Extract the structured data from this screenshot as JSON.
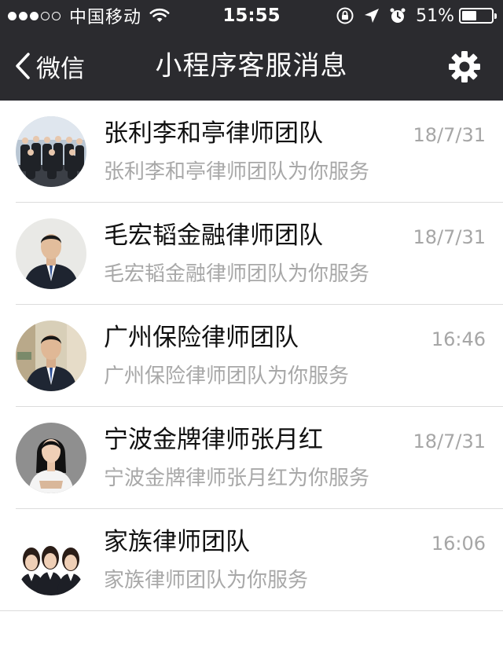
{
  "status_bar": {
    "carrier": "中国移动",
    "time": "15:55",
    "battery_percent": "51%",
    "battery_level": 0.51,
    "signal_bars_filled": 3,
    "signal_bars_total": 5
  },
  "nav": {
    "back_label": "微信",
    "title": "小程序客服消息",
    "back_icon": "chevron-left-icon",
    "settings_icon": "gear-icon"
  },
  "colors": {
    "header_bg": "#2b2b2f",
    "title_text": "#111111",
    "secondary_text": "#a8a8a8",
    "divider": "#dcdcdc"
  },
  "conversations": [
    {
      "name": "张利李和亭律师团队",
      "time": "18/7/31",
      "preview": "张利李和亭律师团队为你服务",
      "avatar": "group-photo-avatar"
    },
    {
      "name": "毛宏韬金融律师团队",
      "time": "18/7/31",
      "preview": "毛宏韬金融律师团队为你服务",
      "avatar": "man-portrait-avatar"
    },
    {
      "name": "广州保险律师团队",
      "time": "16:46",
      "preview": "广州保险律师团队为你服务",
      "avatar": "man-office-avatar"
    },
    {
      "name": "宁波金牌律师张月红",
      "time": "18/7/31",
      "preview": "宁波金牌律师张月红为你服务",
      "avatar": "woman-portrait-avatar"
    },
    {
      "name": "家族律师团队",
      "time": "16:06",
      "preview": "家族律师团队为你服务",
      "avatar": "women-group-avatar"
    }
  ]
}
